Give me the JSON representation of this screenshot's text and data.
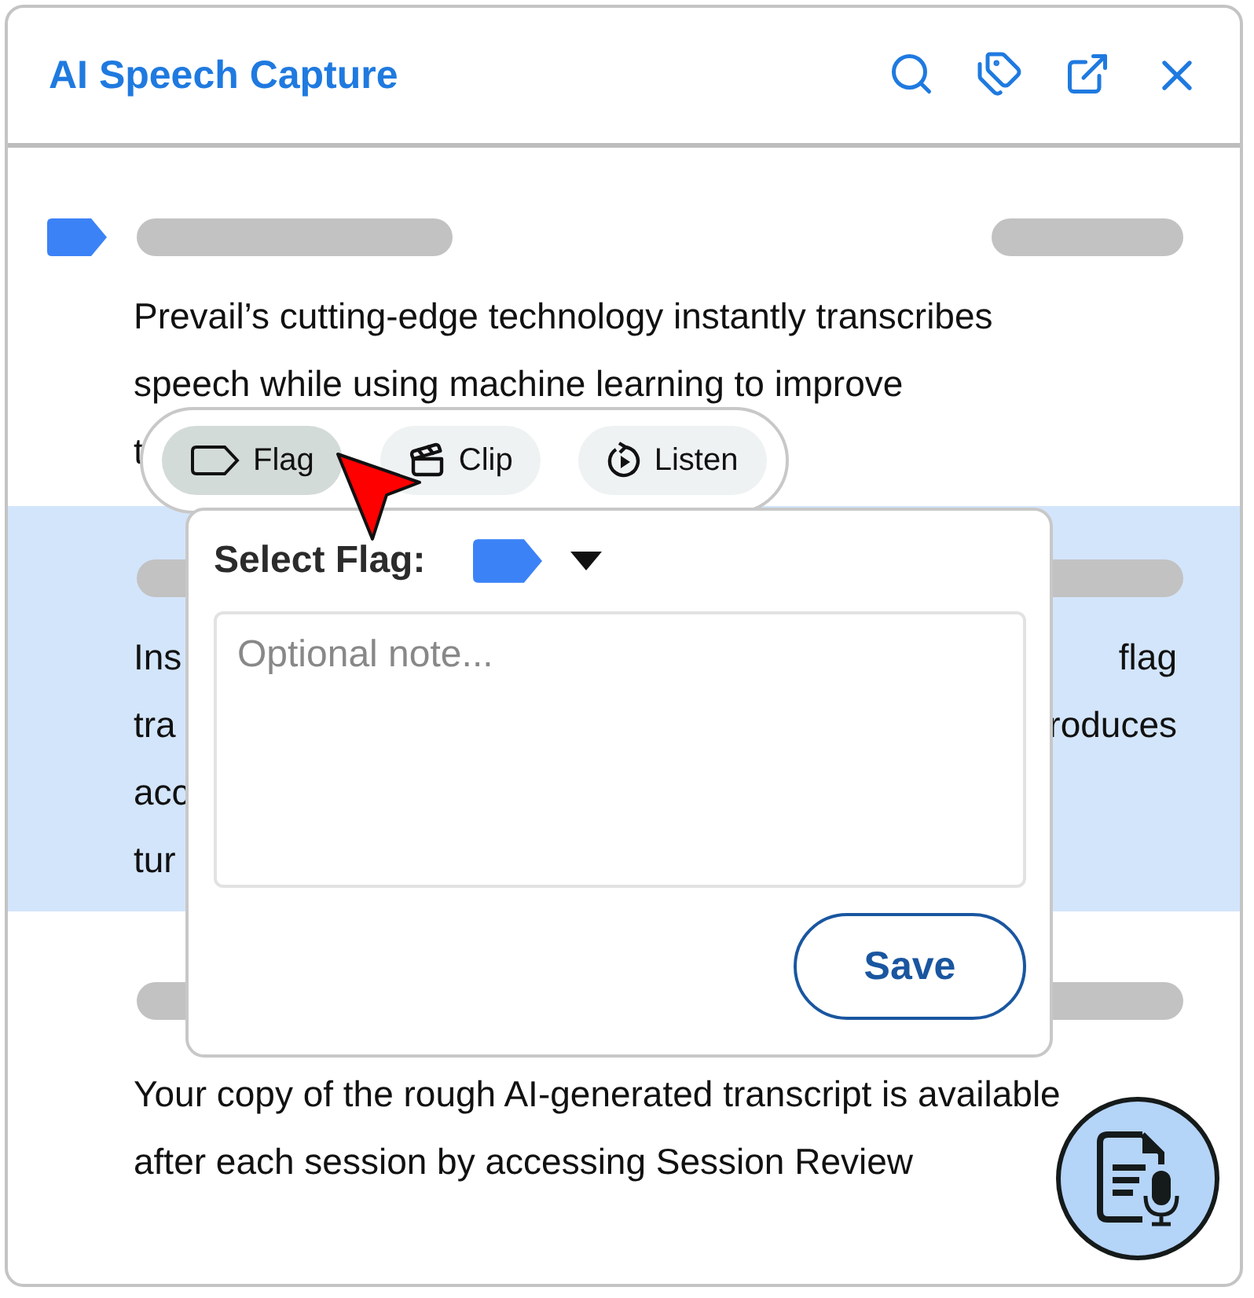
{
  "window": {
    "title": "AI Speech Capture"
  },
  "entries": [
    {
      "flagged": true,
      "highlighted": false,
      "lines": [
        {
          "left": "Prevail’s cutting-edge technology instantly transcribes"
        },
        {
          "left": "speech while using machine learning to improve"
        },
        {
          "left": "t"
        }
      ]
    },
    {
      "flagged": false,
      "highlighted": true,
      "lines": [
        {
          "left": "Ins",
          "right": "flag"
        },
        {
          "left": "tra",
          "right": "roduces"
        },
        {
          "left": "acc"
        },
        {
          "left": "tur"
        }
      ]
    },
    {
      "flagged": false,
      "highlighted": false,
      "lines": [
        {
          "left": "Your copy of the rough AI-generated transcript is available"
        },
        {
          "left": "after each session by accessing Session Review"
        }
      ]
    }
  ],
  "toolbar": [
    {
      "kind": "flag",
      "label": "Flag",
      "selected": true
    },
    {
      "kind": "clip",
      "label": "Clip",
      "selected": false
    },
    {
      "kind": "listen",
      "label": "Listen",
      "selected": false
    }
  ],
  "popover": {
    "label": "Select Flag:",
    "note": {
      "placeholder": "Optional note..."
    },
    "save": "Save"
  }
}
